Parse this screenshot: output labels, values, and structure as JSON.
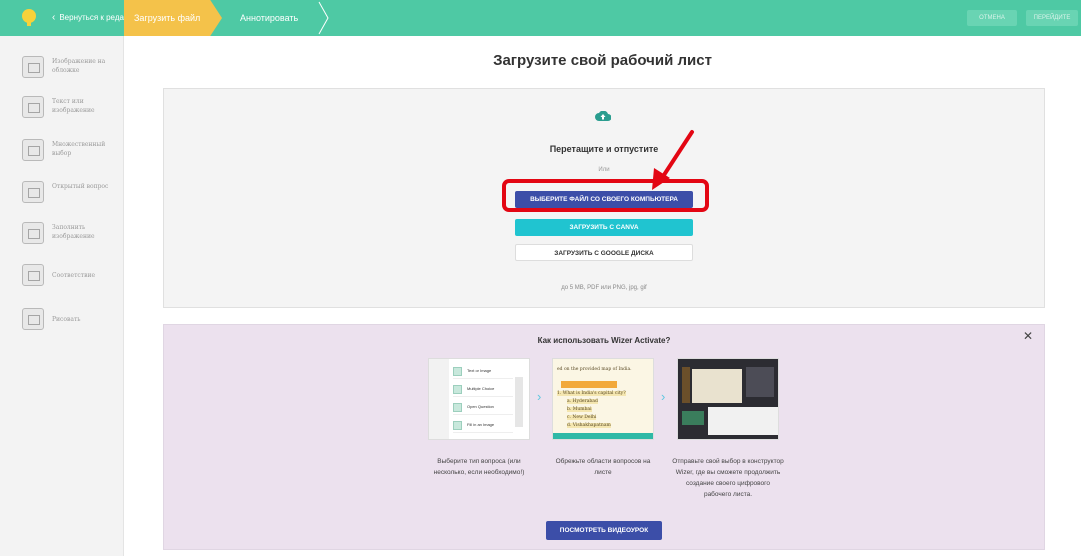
{
  "topbar": {
    "back_label": "Вернуться к редак",
    "step_upload": "Загрузить файл",
    "step_annotate": "Аннотировать",
    "cancel_label": "ОТМЕНА",
    "next_label": "ПЕРЕЙДИТЕ",
    "accent": "#4ec9a4",
    "step_active_color": "#f4c24a"
  },
  "sidebar": {
    "items": [
      {
        "label": "Изображение на обложке",
        "icon": "image-icon"
      },
      {
        "label": "Текст или изображение",
        "icon": "text-image-icon"
      },
      {
        "label": "Множественный выбор",
        "icon": "list-icon"
      },
      {
        "label": "Открытый вопрос",
        "icon": "question-icon"
      },
      {
        "label": "Заполнить изображение",
        "icon": "fill-image-icon"
      },
      {
        "label": "Соответствие",
        "icon": "match-icon"
      },
      {
        "label": "Рисовать",
        "icon": "draw-icon"
      }
    ]
  },
  "main": {
    "title": "Загрузите свой рабочий лист",
    "drag_text": "Перетащите и отпустите",
    "or_text": "Или",
    "choose_button": "ВЫБЕРИТЕ ФАЙЛ СО СВОЕГО КОМПЬЮТЕРА",
    "canva_button": "ЗАГРУЗИТЬ С CANVA",
    "google_button": "ЗАГРУЗИТЬ С GOOGLE ДИСКА",
    "limits_text": "до 5 MB, PDF или PNG, jpg, gif"
  },
  "howto": {
    "title": "Как использовать Wizer Activate?",
    "close_icon": "close-icon",
    "card1_rows": [
      "Text or Image",
      "Multiple Choice",
      "Open Question",
      "Fill in an Image"
    ],
    "card2_lines": [
      "ed on the provided map of India.",
      "1.   What is India's capital city?",
      "a.    Hyderabad",
      "b.    Mumbai",
      "c.    New Delhi",
      "d.    Vishakhapatnam"
    ],
    "step1": "Выберите тип вопроса (или несколько, если необходимо!)",
    "step2": "Обрежьте области вопросов на листе",
    "step3": "Отправьте свой выбор в конструктор Wizer, где вы сможете продолжить создание своего цифрового рабочего листа.",
    "video_button": "ПОСМОТРЕТЬ ВИДЕОУРОК"
  },
  "colors": {
    "primary_button": "#3c4ea8",
    "canva_button": "#20c4d0",
    "annotation_red": "#e30613",
    "panel_bg": "#ece1ee"
  }
}
